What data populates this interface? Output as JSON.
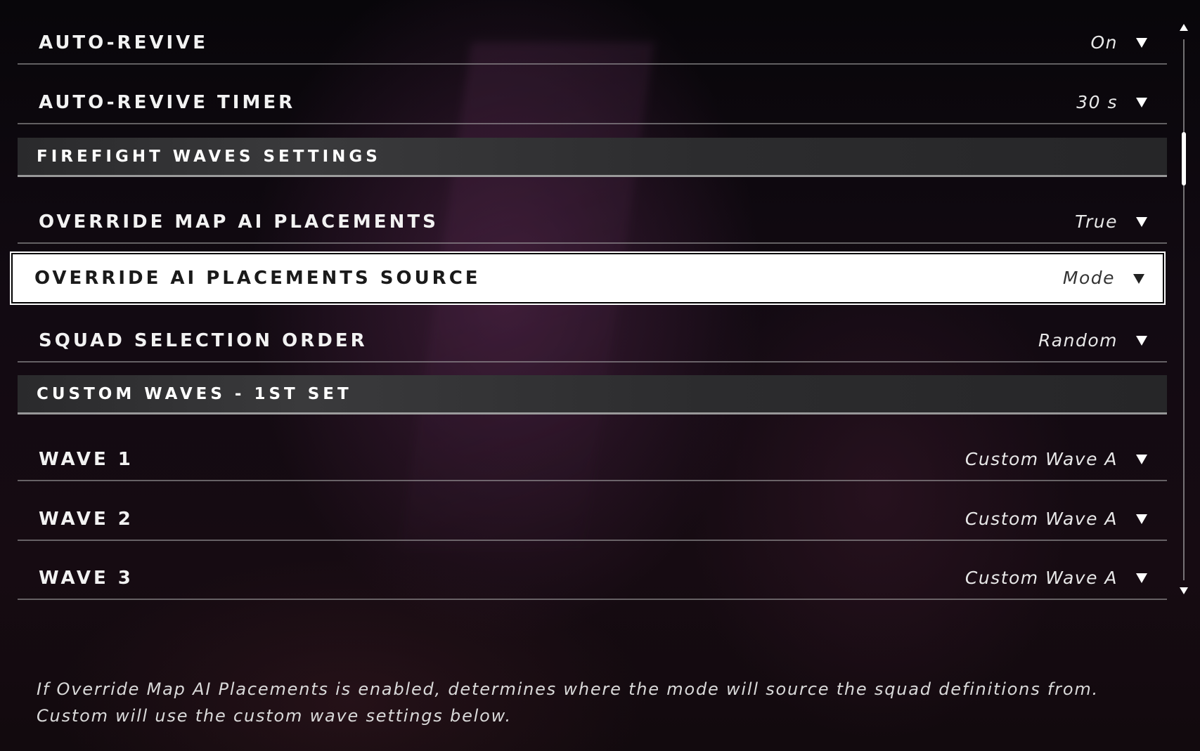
{
  "settings_list": {
    "rows": [
      {
        "kind": "setting",
        "label": "AUTO-REVIVE",
        "value": "On"
      },
      {
        "kind": "setting",
        "label": "AUTO-REVIVE TIMER",
        "value": "30 s"
      },
      {
        "kind": "section",
        "label": "FIREFIGHT WAVES SETTINGS"
      },
      {
        "kind": "setting",
        "label": "OVERRIDE MAP AI PLACEMENTS",
        "value": "True"
      },
      {
        "kind": "setting",
        "label": "OVERRIDE AI PLACEMENTS SOURCE",
        "value": "Mode",
        "selected": true
      },
      {
        "kind": "setting",
        "label": "SQUAD SELECTION ORDER",
        "value": "Random"
      },
      {
        "kind": "section",
        "label": "CUSTOM WAVES - 1ST SET"
      },
      {
        "kind": "setting",
        "label": "WAVE 1",
        "value": "Custom Wave A"
      },
      {
        "kind": "setting",
        "label": "WAVE 2",
        "value": "Custom Wave A"
      },
      {
        "kind": "setting",
        "label": "WAVE 3",
        "value": "Custom Wave A"
      }
    ]
  },
  "icons": {
    "dropdown": "chevron-down-icon",
    "scroll_up": "scroll-up-arrow-icon",
    "scroll_down": "scroll-down-arrow-icon"
  },
  "description": "If Override Map AI Placements is enabled, determines where the mode will source the squad definitions from. Custom will use the custom wave settings below.",
  "colors": {
    "selected_background": "#ffffff",
    "selected_text": "#1a1a1a",
    "section_background": "#333335",
    "text": "#f2f2f2"
  }
}
